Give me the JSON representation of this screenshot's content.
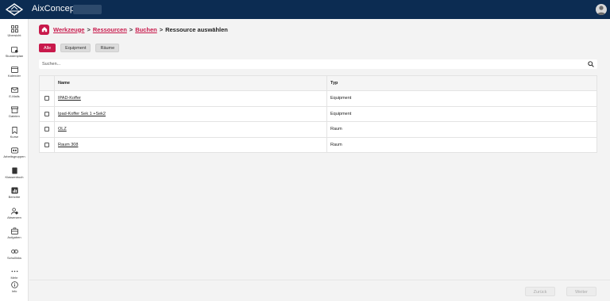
{
  "topbar": {
    "title": "AixConcept -"
  },
  "sidebar": {
    "items": [
      {
        "label": "Übersicht",
        "icon": "grid-icon"
      },
      {
        "label": "Stundenplan",
        "icon": "calendar-clock-icon"
      },
      {
        "label": "Kalender",
        "icon": "calendar-icon"
      },
      {
        "label": "E-Mails",
        "icon": "mail-icon"
      },
      {
        "label": "Dateien",
        "icon": "archive-icon"
      },
      {
        "label": "Kurse",
        "icon": "bookmark-icon"
      },
      {
        "label": "Arbeitsgruppen",
        "icon": "group-icon"
      },
      {
        "label": "Klassenbuch",
        "icon": "book-icon"
      },
      {
        "label": "Berichte",
        "icon": "chart-icon"
      },
      {
        "label": "Absenzen",
        "icon": "user-absence-icon"
      },
      {
        "label": "Aufgaben",
        "icon": "briefcase-icon"
      },
      {
        "label": "Schullinks",
        "icon": "link-icon"
      },
      {
        "label": "Mehr",
        "icon": "more-icon"
      },
      {
        "label": "Info",
        "icon": "info-icon"
      }
    ]
  },
  "breadcrumb": {
    "items": [
      "Werkzeuge",
      "Ressourcen",
      "Buchen"
    ],
    "current": "Ressource auswählen",
    "separator": ">"
  },
  "filters": {
    "all": "Alle",
    "equipment": "Equipment",
    "rooms": "Räume"
  },
  "search": {
    "placeholder": "Suchen..."
  },
  "table": {
    "headers": {
      "name": "Name",
      "type": "Typ"
    },
    "rows": [
      {
        "name": "IPAD-Koffer",
        "type": "Equipment"
      },
      {
        "name": "Ipad-Koffer Sek 1 +Sek2",
        "type": "Equipment"
      },
      {
        "name": "OLZ",
        "type": "Raum"
      },
      {
        "name": "Raum 308",
        "type": "Raum"
      }
    ]
  },
  "footer": {
    "back": "Zurück",
    "next": "Weiter"
  },
  "colors": {
    "brand": "#c8194b",
    "topbar": "#0c2c52"
  }
}
